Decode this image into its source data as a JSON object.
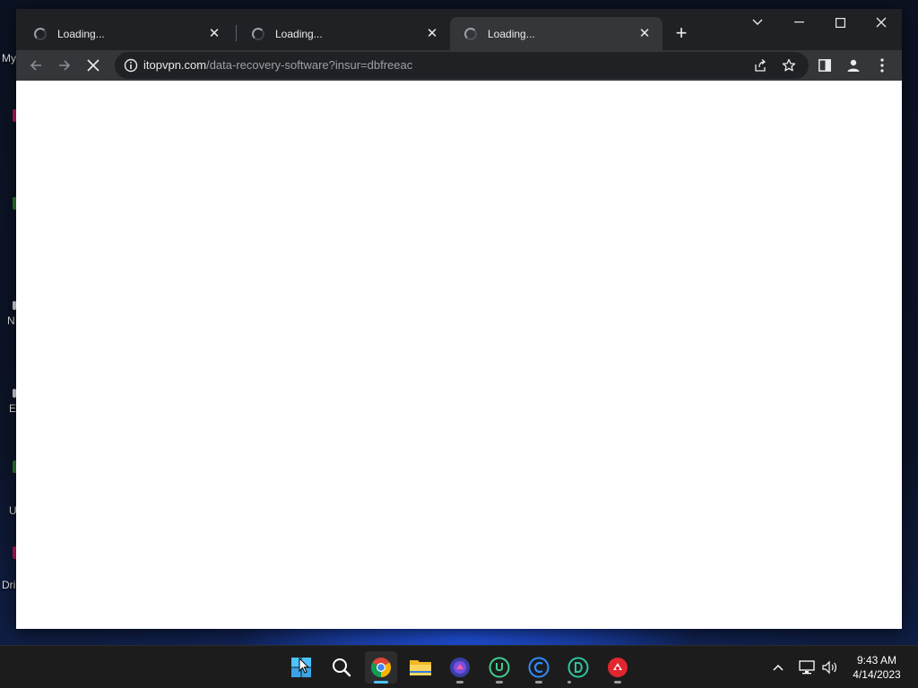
{
  "desktop": {
    "top_label": "My",
    "icons": [
      {
        "label": "",
        "color": "#c2185b"
      },
      {
        "label": "",
        "color": "#2e7d32"
      },
      {
        "label": "N",
        "color": "#2962ff"
      },
      {
        "label": "E",
        "color": "#e0e0e0"
      },
      {
        "label": "U",
        "color": "#2e7d32"
      },
      {
        "label": "Dri",
        "color": "#c2185b"
      }
    ]
  },
  "browser": {
    "tabs": [
      {
        "title": "Loading...",
        "state": "loading",
        "active": false
      },
      {
        "title": "Loading...",
        "state": "loading",
        "active": false
      },
      {
        "title": "Loading...",
        "state": "loading",
        "active": true
      }
    ],
    "new_tab_icon": "plus-icon",
    "window_controls": [
      "tab-search-icon",
      "minimize-icon",
      "maximize-icon",
      "close-icon"
    ],
    "toolbar": {
      "back_icon": "arrow-left-icon",
      "forward_icon": "arrow-right-icon",
      "stop_icon": "stop-loading-icon"
    },
    "address_bar": {
      "host": "itopvpn.com",
      "path": "/data-recovery-software?insur=dbfreeac",
      "site_info_icon": "info-icon"
    },
    "omnibox_actions": [
      "share-icon",
      "bookmark-star-icon"
    ],
    "toolbar_right": [
      "side-panel-icon",
      "profile-icon",
      "menu-dots-icon"
    ],
    "page_background": "#ffffff",
    "accent": "#202124"
  },
  "taskbar": {
    "apps": [
      {
        "name": "start-icon",
        "active": false
      },
      {
        "name": "search-icon",
        "active": false
      },
      {
        "name": "chrome-icon",
        "active": true
      },
      {
        "name": "file-explorer-icon",
        "active": false
      },
      {
        "name": "app-purple-icon",
        "active": false
      },
      {
        "name": "app-u-icon",
        "active": false
      },
      {
        "name": "app-c-icon",
        "active": false
      },
      {
        "name": "app-d-icon",
        "active": false
      },
      {
        "name": "app-red-icon",
        "active": false
      }
    ],
    "tray": [
      "chevron-up-icon",
      "network-icon",
      "volume-icon"
    ],
    "clock": {
      "time": "9:43 AM",
      "date": "4/14/2023"
    },
    "pill_active_color": "#4cc2ff"
  }
}
